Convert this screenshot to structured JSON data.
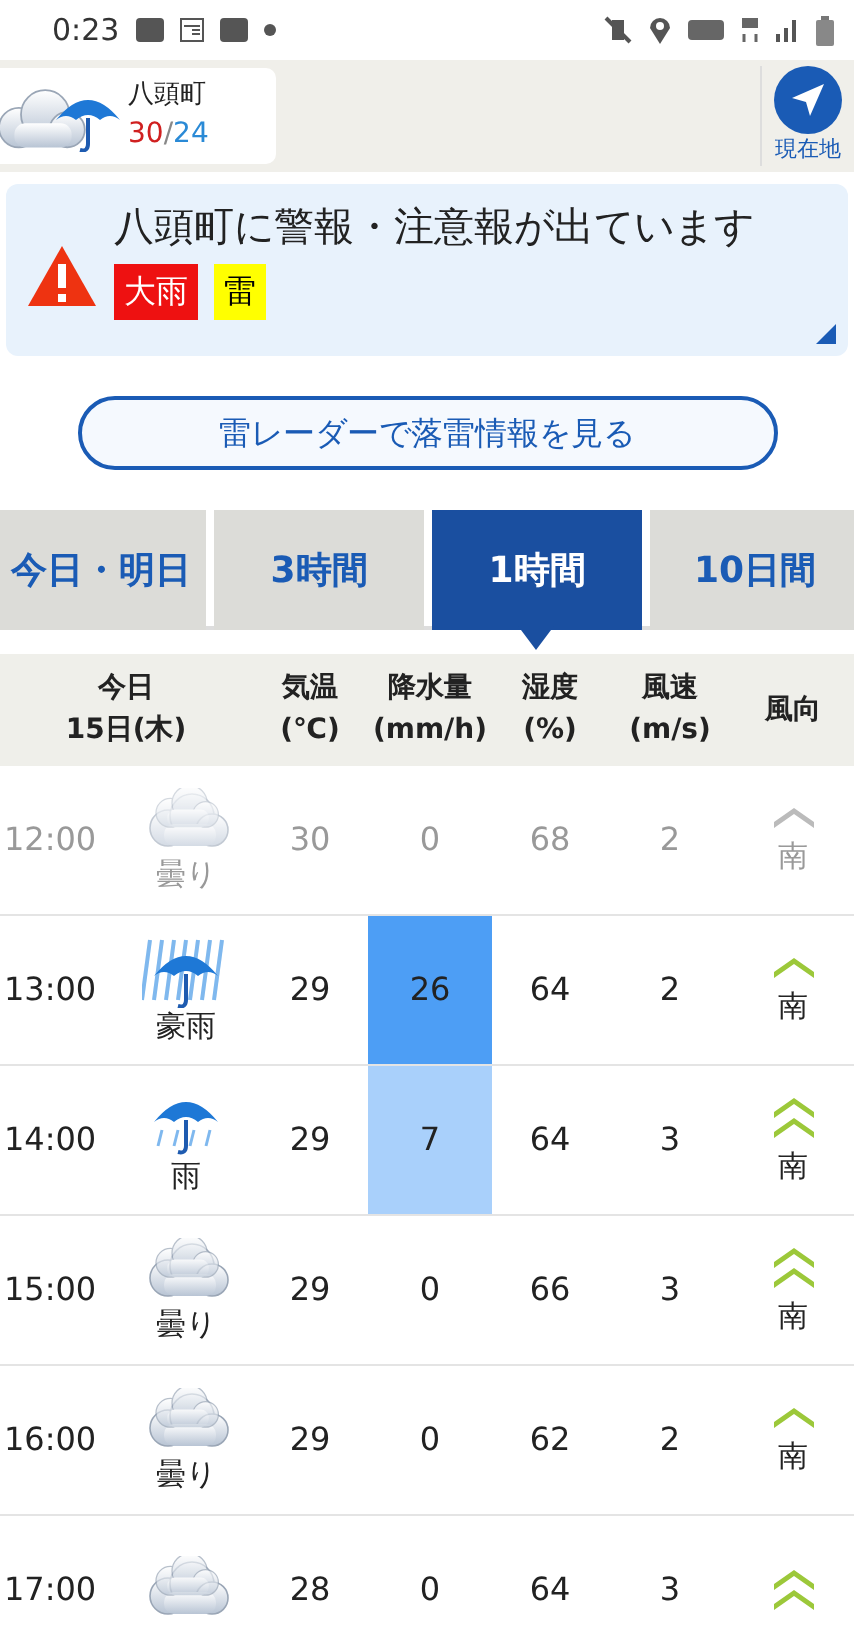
{
  "status_bar": {
    "time": "0:23"
  },
  "location": {
    "name": "八頭町",
    "high": "30",
    "separator": "/",
    "low": "24",
    "current_button": "現在地"
  },
  "alert": {
    "title": "八頭町に警報・注意報が出ています",
    "tags": [
      {
        "label": "大雨",
        "color": "#ee1111"
      },
      {
        "label": "雷",
        "color": "#ffff00"
      }
    ]
  },
  "radar_button": "雷レーダーで落雷情報を見る",
  "tabs": [
    {
      "label": "今日・明日",
      "selected": false
    },
    {
      "label": "3時間",
      "selected": false
    },
    {
      "label": "1時間",
      "selected": true
    },
    {
      "label": "10日間",
      "selected": false
    }
  ],
  "table": {
    "columns": [
      {
        "lines": [
          "今日",
          "15日(木)"
        ]
      },
      {
        "lines": [
          "気温",
          "(℃)"
        ]
      },
      {
        "lines": [
          "降水量",
          "(mm/h)"
        ]
      },
      {
        "lines": [
          "湿度",
          "(%)"
        ]
      },
      {
        "lines": [
          "風速",
          "(m/s)"
        ]
      },
      {
        "lines": [
          "風向"
        ]
      }
    ],
    "rows": [
      {
        "time": "12:00",
        "past": true,
        "kind": "cloudy",
        "weather": "曇り",
        "temp": "30",
        "rain": "0",
        "humidity": "68",
        "wind": "2",
        "strong": false,
        "direction": "南"
      },
      {
        "time": "13:00",
        "past": false,
        "kind": "heavy-rain",
        "weather": "豪雨",
        "temp": "29",
        "rain": "26",
        "color": "#4d9ef5",
        "humidity": "64",
        "wind": "2",
        "strong": false,
        "direction": "南"
      },
      {
        "time": "14:00",
        "past": false,
        "kind": "rain",
        "weather": "雨",
        "temp": "29",
        "rain": "7",
        "color": "#a9d0fb",
        "humidity": "64",
        "wind": "3",
        "strong": true,
        "direction": "南"
      },
      {
        "time": "15:00",
        "past": false,
        "kind": "cloudy",
        "weather": "曇り",
        "temp": "29",
        "rain": "0",
        "humidity": "66",
        "wind": "3",
        "strong": true,
        "direction": "南"
      },
      {
        "time": "16:00",
        "past": false,
        "kind": "cloudy",
        "weather": "曇り",
        "temp": "29",
        "rain": "0",
        "humidity": "62",
        "wind": "2",
        "strong": false,
        "direction": "南"
      },
      {
        "time": "17:00",
        "past": false,
        "kind": "cloudy",
        "temp": "28",
        "rain": "0",
        "humidity": "64",
        "wind": "3",
        "strong": true
      }
    ]
  }
}
